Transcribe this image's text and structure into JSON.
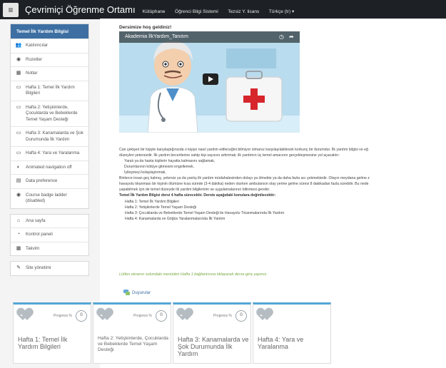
{
  "header": {
    "menu_icon": "hamburger-icon",
    "brand": "Çevrimiçi Öğrenme Ortamı",
    "nav": [
      "Kütüphane",
      "Öğrenci Bilgi Sistemi",
      "Tezsiz Y. lisans",
      "Türkçe (tr) ▾"
    ]
  },
  "sidebar": {
    "course_title": "Temel İlk Yardım Bilgisi",
    "course_items": [
      {
        "icon": "users-icon",
        "label": "Katılımcılar"
      },
      {
        "icon": "badge-icon",
        "label": "Rozetler"
      },
      {
        "icon": "grades-icon",
        "label": "Notlar"
      },
      {
        "icon": "folder-icon",
        "label": "Hafta 1: Temel İlk Yardım Bilgileri"
      },
      {
        "icon": "folder-icon",
        "label": "Hafta 2: Yetişkinlerde, Çocuklarda ve Bebeklerde Temel Yaşam Desteği"
      },
      {
        "icon": "folder-icon",
        "label": "Hafta 3: Kanamalarda ve Şok Durumunda İlk Yardım"
      },
      {
        "icon": "folder-icon",
        "label": "Hafta 4: Yara ve Yaralanma"
      },
      {
        "icon": "toggle-icon",
        "label": "Animated navigation off"
      },
      {
        "icon": "data-icon",
        "label": "Data preference"
      },
      {
        "icon": "badge-icon",
        "label": "Course badge ladder (disabled)"
      }
    ],
    "site_items": [
      {
        "icon": "home-icon",
        "label": "Ana sayfa"
      },
      {
        "icon": "dashboard-icon",
        "label": "Kontrol paneli"
      },
      {
        "icon": "calendar-icon",
        "label": "Takvim"
      }
    ],
    "admin_items": [
      {
        "icon": "wrench-icon",
        "label": "Site yönetimi"
      }
    ]
  },
  "main": {
    "welcome": "Dersimize hoş geldiniz!",
    "video": {
      "title": "Akademia İlkYardım_Tanıtım",
      "clock_icon": "clock-icon",
      "share_icon": "share-icon",
      "play_icon": "play-icon"
    },
    "paragraph1": "Can çekişen bir kişiyle karşılaştığınızda o kişiye nasıl yardım edileceğini bilmiyor olmanız karşılaşılabilecek korkunç bir durumdur. İlk yardım bilgisi ve eğ",
    "paragraph1b": "düzeyleri yetersizdir. İlk yardım becerilerine sahip kişi sayısını arttırmak; ilk yardımın üç temel amacının gerçekleşmesine yol açacaktır:",
    "aims": [
      "Yaralı ya da hasta kişilerin hayatta kalmasını sağlamak,",
      "Durumlarının kötüye gitmesini engellemek,",
      "İyileşmeyi kolaylaştırmak."
    ],
    "paragraph2": "Binlerce insan geç kalmış, yetersiz ya da yanlış ilk yardım müdahalesinden dolayı ya ölmekte ya da daha fazla acı çekmektedir. Olayın meydana gelme z",
    "paragraph2b": "havayolu tıkanması bir kişinin ölümüne kısa sürede (3-4 dakika) neden olurken ambulansın olay yerine gelme süresi 8 dakikadan fazla sürebilir. Bu nede",
    "paragraph2c": "yapabilmek için de temel düzeyde ilk yardım bilgilerinin ve uygulamalarının bilinmesi gerekir.",
    "bold_line": "Temel İlk Yardım Bilgisi dersi 4 hafta sürecektir. Derste aşağıdaki konulara değinilecektir:",
    "weeks": [
      "Hafta 1: Temel İlk Yardım Bilgileri",
      "Hafta 2: Yetişkinlerde Temel Yaşam Desteği",
      "Hafta 3: Çocuklarda ve Bebeklerde Temel Yaşam Desteği ile Havayolu Tıkanmalarında İlk Yardım",
      "Hafta 4: Kanamalarda ve Göğüs Yaralanmalarında İlk Yardım"
    ],
    "note": "Lütfen ekranın solundaki menüden Hafta 1 bağlantısına tıklayarak derse giriş yapınız.",
    "forum_label": "Duyurular"
  },
  "cards": [
    {
      "progress_label": "Progress %",
      "progress": "0",
      "title": "Hafta 1: Temel İlk Yardım Bilgileri",
      "small": false
    },
    {
      "progress_label": "Progress %",
      "progress": "0",
      "title": "Hafta 2: Yetişkinlerde, Çocuklarda ve Bebeklerde Temel Yaşam Desteği",
      "small": true
    },
    {
      "progress_label": "Progress %",
      "progress": "0",
      "title": "Hafta 3: Kanamalarda ve Şok Durumunda İlk Yardım",
      "small": false
    },
    {
      "progress_label": "",
      "progress": "",
      "title": "Hafta 4: Yara ve Yaralanma",
      "small": false
    }
  ]
}
